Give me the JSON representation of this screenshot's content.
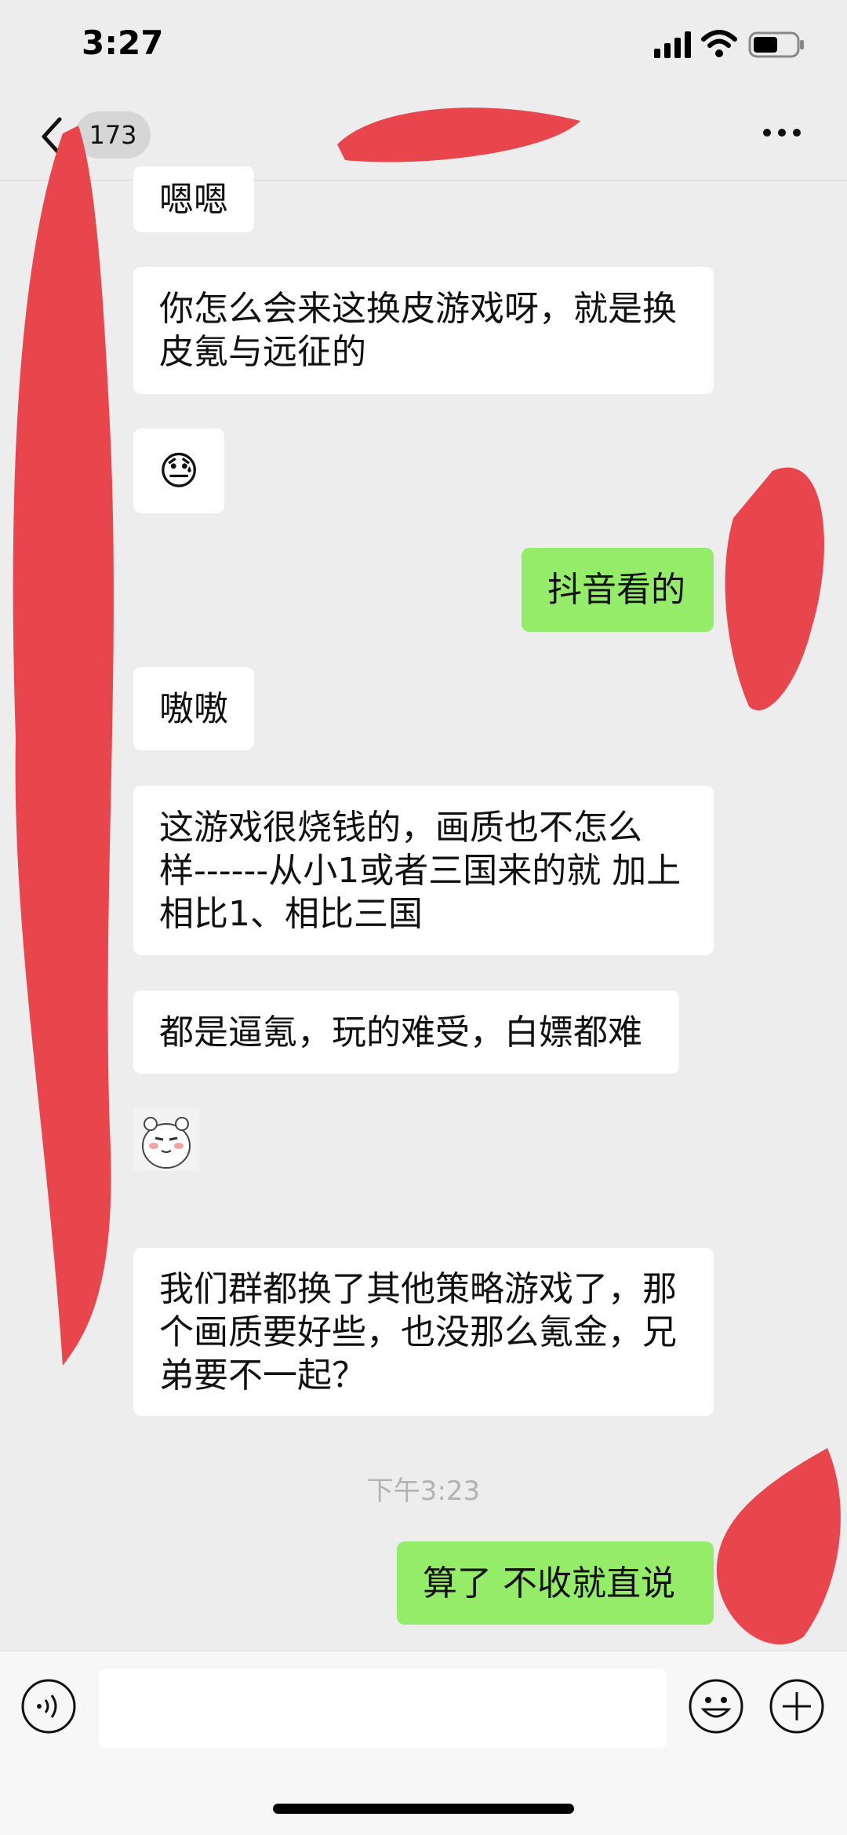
{
  "status_bar": {
    "time": "3:27"
  },
  "nav": {
    "unread_count": "173"
  },
  "messages": [
    {
      "text": "嗯嗯"
    },
    {
      "text": "你怎么会来这换皮游戏呀，就是换皮氪与远征的"
    },
    {
      "emoji": "😓"
    },
    {
      "text": "抖音看的"
    },
    {
      "text": "嗷嗷"
    },
    {
      "text": "这游戏很烧钱的，画质也不怎么样------从小1或者三国来的就 加上相比1、相比三国"
    },
    {
      "text": "都是逼氪，玩的难受，白嫖都难"
    },
    {
      "text": "我们群都换了其他策略游戏了，那个画质要好些，也没那么氪金，兄弟要不一起？"
    },
    {
      "text": "算了  不收就直说"
    }
  ],
  "timestamp": "下午3:23",
  "colors": {
    "sent_bubble": "#95ec69",
    "received_bubble": "#ffffff",
    "background": "#ededed",
    "redaction": "#e8454d"
  }
}
